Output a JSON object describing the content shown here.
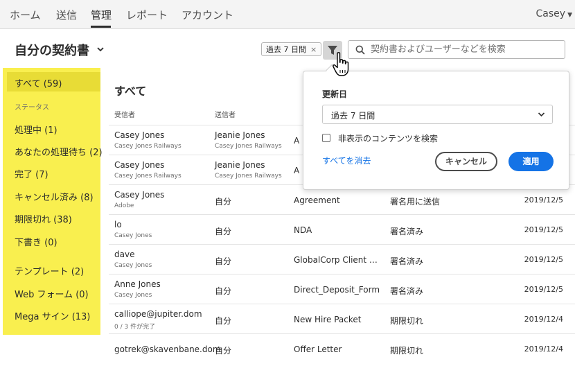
{
  "nav": {
    "tabs": [
      "ホーム",
      "送信",
      "管理",
      "レポート",
      "アカウント"
    ],
    "active": "管理",
    "user": "Casey"
  },
  "header": {
    "title": "自分の契約書",
    "filter_chip": "過去 7 日間",
    "search_placeholder": "契約書およびユーザーなどを検索"
  },
  "sidebar": {
    "all": "すべて (59)",
    "section": "ステータス",
    "status_items": [
      "処理中 (1)",
      "あなたの処理待ち (2)",
      "完了 (7)",
      "キャンセル済み (8)",
      "期限切れ (38)",
      "下書き (0)"
    ],
    "other_items": [
      "テンプレート (2)",
      "Web フォーム (0)",
      "Mega サイン (13)"
    ]
  },
  "main": {
    "title": "すべて",
    "columns": {
      "recipient": "受信者",
      "sender": "送信者"
    },
    "rows": [
      {
        "name": "Casey Jones",
        "sub": "Casey Jones Railways",
        "sender": "Jeanie Jones",
        "sender_sub": "Casey Jones Railways",
        "title": "A",
        "status": "",
        "date": ""
      },
      {
        "name": "Casey Jones",
        "sub": "Casey Jones Railways",
        "sender": "Jeanie Jones",
        "sender_sub": "Casey Jones Railways",
        "title": "A",
        "status": "",
        "date": ""
      },
      {
        "name": "Casey Jones",
        "sub": "Adobe",
        "sender": "自分",
        "sender_sub": "",
        "title": "Agreement",
        "status": "署名用に送信",
        "date": "2019/12/5"
      },
      {
        "name": "lo",
        "sub": "Casey Jones",
        "sender": "自分",
        "sender_sub": "",
        "title": "NDA",
        "status": "署名済み",
        "date": "2019/12/5"
      },
      {
        "name": "dave",
        "sub": "Casey Jones",
        "sender": "自分",
        "sender_sub": "",
        "title": "GlobalCorp Client S...",
        "status": "署名済み",
        "date": "2019/12/5"
      },
      {
        "name": "Anne Jones",
        "sub": "Casey Jones",
        "sender": "自分",
        "sender_sub": "",
        "title": "Direct_Deposit_Form",
        "status": "署名済み",
        "date": "2019/12/5"
      },
      {
        "name": "calliope@jupiter.dom",
        "sub": "0 / 3 件が完了",
        "sender": "自分",
        "sender_sub": "",
        "title": "New Hire Packet",
        "status": "期限切れ",
        "date": "2019/12/4"
      },
      {
        "name": "gotrek@skavenbane.dom",
        "sub": "",
        "sender": "自分",
        "sender_sub": "",
        "title": "Offer Letter",
        "status": "期限切れ",
        "date": "2019/12/4"
      }
    ]
  },
  "popover": {
    "label": "更新日",
    "selected_option": "過去 7 日間",
    "checkbox_label": "非表示のコンテンツを検索",
    "checkbox_checked": false,
    "clear_link": "すべてを消去",
    "cancel_label": "キャンセル",
    "apply_label": "適用"
  },
  "colors": {
    "accent": "#1473e6",
    "sidebar_highlight": "#f9ef4f",
    "sidebar_selected": "#e8dc36"
  }
}
